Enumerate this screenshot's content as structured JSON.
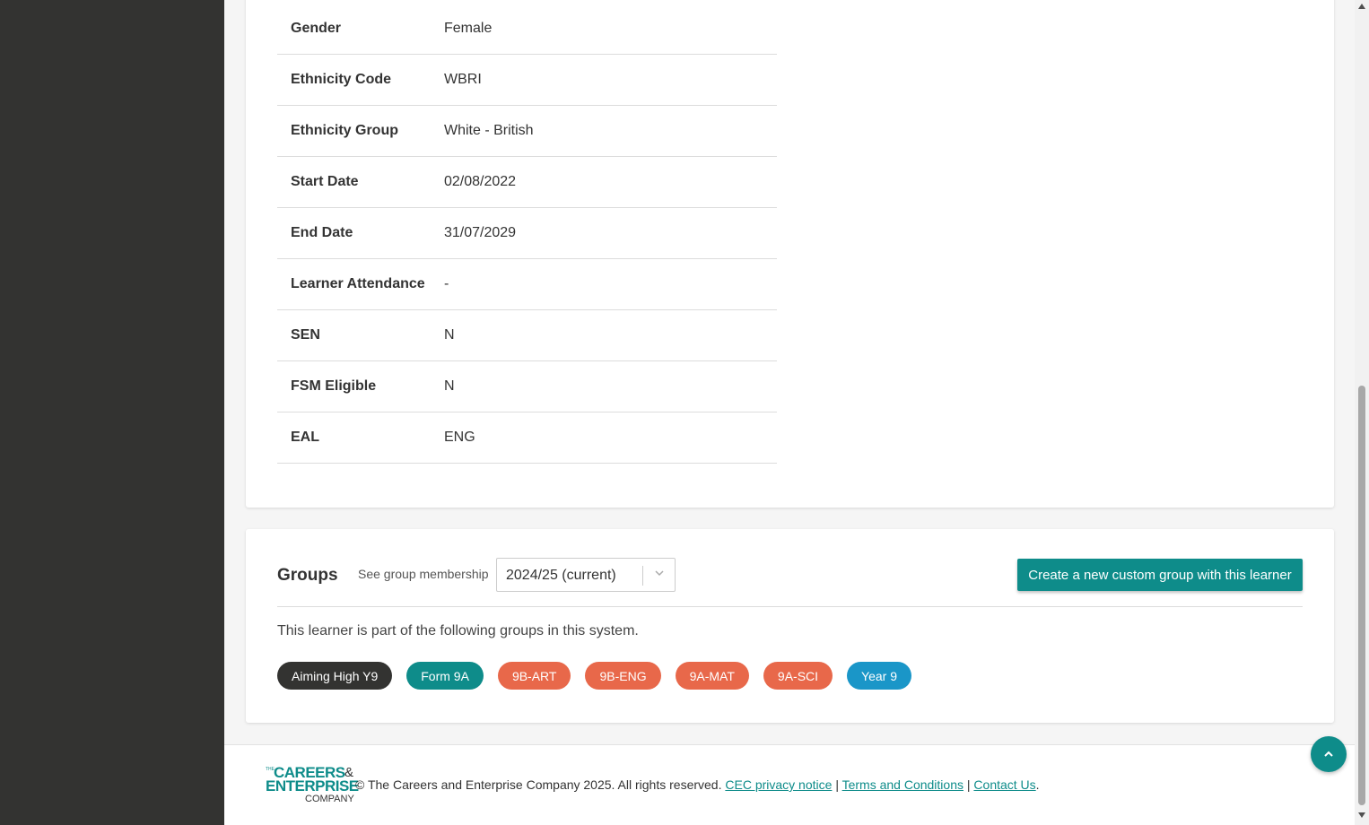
{
  "details": {
    "rows": [
      {
        "label": "Gender",
        "value": "Female"
      },
      {
        "label": "Ethnicity Code",
        "value": "WBRI"
      },
      {
        "label": "Ethnicity Group",
        "value": "White - British"
      },
      {
        "label": "Start Date",
        "value": "02/08/2022"
      },
      {
        "label": "End Date",
        "value": "31/07/2029"
      },
      {
        "label": "Learner Attendance",
        "value": "-"
      },
      {
        "label": "SEN",
        "value": "N"
      },
      {
        "label": "FSM Eligible",
        "value": "N"
      },
      {
        "label": "EAL",
        "value": "ENG"
      }
    ]
  },
  "groups": {
    "title": "Groups",
    "see_label": "See group membership",
    "selected_year": "2024/25 (current)",
    "create_button": "Create a new custom group with this learner",
    "description": "This learner is part of the following groups in this system.",
    "chips": [
      {
        "label": "Aiming High Y9",
        "color": "#333331"
      },
      {
        "label": "Form 9A",
        "color": "#0e8c8a"
      },
      {
        "label": "9B-ART",
        "color": "#e8684a"
      },
      {
        "label": "9B-ENG",
        "color": "#e8684a"
      },
      {
        "label": "9A-MAT",
        "color": "#e8684a"
      },
      {
        "label": "9A-SCI",
        "color": "#e8684a"
      },
      {
        "label": "Year 9",
        "color": "#1a96c8"
      }
    ]
  },
  "footer": {
    "logo": {
      "the": "THE",
      "line1": "CAREERS",
      "amp": "&",
      "line2": "ENTERPRISE",
      "line3": "COMPANY"
    },
    "copyright": "© The Careers and Enterprise Company 2025. All rights reserved.",
    "links": {
      "privacy": "CEC privacy notice",
      "terms": "Terms and Conditions",
      "contact": "Contact Us"
    },
    "sep1": "|",
    "sep2": "|",
    "period": "."
  },
  "colors": {
    "accent": "#0e8c8a",
    "sidebar": "#333331"
  },
  "icons": {
    "select": "chevron-down-icon",
    "back_to_top": "chevron-up-icon"
  }
}
